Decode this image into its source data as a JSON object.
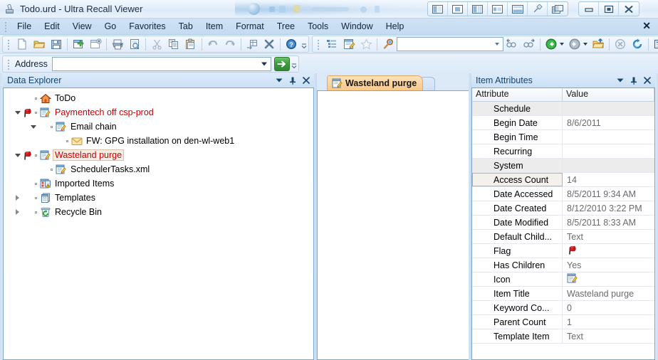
{
  "window": {
    "title": "Todo.urd - Ultra Recall Viewer",
    "icon": "ultrarecall-icon",
    "layout_buttons": [
      {
        "name": "layout-left-pane-icon",
        "label": ""
      },
      {
        "name": "layout-center-pane-icon",
        "label": ""
      },
      {
        "name": "layout-right-pane-icon",
        "label": ""
      },
      {
        "name": "layout-split-pane-icon",
        "label": ""
      },
      {
        "name": "layout-horizontal-split-icon",
        "label": ""
      },
      {
        "name": "pin-layout-icon",
        "label": ""
      },
      {
        "name": "layout-overlay-icon",
        "label": ""
      }
    ],
    "controls": [
      {
        "name": "minimize-button",
        "glyph": "minimize"
      },
      {
        "name": "restore-button",
        "glyph": "restore"
      },
      {
        "name": "close-button",
        "glyph": "close"
      }
    ]
  },
  "menubar": {
    "items": [
      "File",
      "Edit",
      "View",
      "Go",
      "Favorites",
      "Tab",
      "Item",
      "Format",
      "Tree",
      "Tools",
      "Window",
      "Help"
    ],
    "close_label": "✕"
  },
  "toolbar_main": {
    "buttons": [
      "new-document-icon",
      "open-folder-icon",
      "save-icon",
      "new-item-icon",
      "close-item-icon",
      "print-icon",
      "print-preview-icon",
      "cut-icon",
      "copy-icon",
      "paste-icon",
      "undo-icon",
      "redo-icon",
      "insert-object-icon",
      "delete-icon",
      "help-icon"
    ],
    "overflow_label": "»"
  },
  "toolbar_secondary": {
    "buttons": [
      "outline-view-icon",
      "edit-item-icon",
      "favorite-star-icon"
    ],
    "search_icon": "search-magnifier-icon",
    "search_value": "",
    "search_placeholder": "",
    "nav_buttons": [
      "find-previous-icon",
      "find-next-icon",
      "back-icon",
      "back-dropdown-icon",
      "forward-icon",
      "forward-dropdown-icon",
      "go-up-folder-icon",
      "stop-icon",
      "refresh-icon",
      "view-mode-icon",
      "view-mode-dropdown-icon",
      "columns-icon"
    ],
    "overflow_label": "»"
  },
  "address_bar": {
    "label": "Address",
    "value": "",
    "placeholder": "",
    "go_button": "go-arrow-button",
    "overflow_label": "»"
  },
  "data_explorer": {
    "title": "Data Explorer",
    "header_buttons": [
      {
        "name": "panel-menu-dropdown",
        "glyph": "▼"
      },
      {
        "name": "panel-pin-button",
        "glyph": "pin"
      },
      {
        "name": "panel-close-button",
        "glyph": "✕"
      }
    ],
    "tree": [
      {
        "label": "ToDo",
        "icon": "home-icon",
        "indent": 0,
        "expander": "none",
        "flag": false,
        "color": "black",
        "selected": false
      },
      {
        "label": "Paymentech off csp-prod",
        "icon": "note-edit-icon",
        "indent": 0,
        "expander": "open",
        "flag": true,
        "color": "red",
        "selected": false
      },
      {
        "label": "Email chain",
        "icon": "note-edit-icon",
        "indent": 1,
        "expander": "open",
        "flag": false,
        "color": "black",
        "selected": false
      },
      {
        "label": "FW: GPG installation on den-wl-web1",
        "icon": "envelope-icon",
        "indent": 2,
        "expander": "none",
        "flag": false,
        "color": "black",
        "selected": false
      },
      {
        "label": "Wasteland purge",
        "icon": "note-edit-icon",
        "indent": 0,
        "expander": "open",
        "flag": true,
        "color": "red",
        "selected": true
      },
      {
        "label": "SchedulerTasks.xml",
        "icon": "note-edit-icon",
        "indent": 1,
        "expander": "none",
        "flag": false,
        "color": "black",
        "selected": false
      },
      {
        "label": "Imported Items",
        "icon": "imported-items-icon",
        "indent": 0,
        "expander": "none",
        "flag": false,
        "color": "black",
        "selected": false
      },
      {
        "label": "Templates",
        "icon": "templates-icon",
        "indent": 0,
        "expander": "closed",
        "flag": false,
        "color": "black",
        "selected": false
      },
      {
        "label": "Recycle Bin",
        "icon": "recycle-bin-icon",
        "indent": 0,
        "expander": "closed",
        "flag": false,
        "color": "black",
        "selected": false
      }
    ]
  },
  "document_area": {
    "active_tab": "Wasteland purge",
    "active_tab_icon": "note-edit-icon",
    "new_tab_name": "new-tab-button",
    "content": ""
  },
  "item_attributes": {
    "title": "Item Attributes",
    "header_buttons": [
      {
        "name": "panel-menu-dropdown",
        "glyph": "▼"
      },
      {
        "name": "panel-pin-button",
        "glyph": "pin"
      },
      {
        "name": "panel-close-button",
        "glyph": "✕"
      }
    ],
    "columns": [
      "Attribute",
      "Value"
    ],
    "rows": [
      {
        "attribute": "Schedule",
        "value": "",
        "group": true,
        "selected": false,
        "icon": null
      },
      {
        "attribute": "Begin Date",
        "value": "8/6/2011",
        "group": false,
        "selected": false,
        "icon": null
      },
      {
        "attribute": "Begin Time",
        "value": "",
        "group": false,
        "selected": false,
        "icon": null
      },
      {
        "attribute": "Recurring",
        "value": "",
        "group": false,
        "selected": false,
        "icon": null
      },
      {
        "attribute": "System",
        "value": "",
        "group": true,
        "selected": false,
        "icon": null
      },
      {
        "attribute": "Access Count",
        "value": "14",
        "group": false,
        "selected": true,
        "icon": null
      },
      {
        "attribute": "Date Accessed",
        "value": "8/5/2011 9:34 AM",
        "group": false,
        "selected": false,
        "icon": null
      },
      {
        "attribute": "Date Created",
        "value": "8/12/2010 3:22 PM",
        "group": false,
        "selected": false,
        "icon": null
      },
      {
        "attribute": "Date Modified",
        "value": "8/5/2011 8:33 AM",
        "group": false,
        "selected": false,
        "icon": null
      },
      {
        "attribute": "Default Child...",
        "value": "Text",
        "group": false,
        "selected": false,
        "icon": null
      },
      {
        "attribute": "Flag",
        "value": "",
        "group": false,
        "selected": false,
        "icon": "flag-icon"
      },
      {
        "attribute": "Has Children",
        "value": "Yes",
        "group": false,
        "selected": false,
        "icon": null
      },
      {
        "attribute": "Icon",
        "value": "",
        "group": false,
        "selected": false,
        "icon": "note-edit-icon"
      },
      {
        "attribute": "Item Title",
        "value": "Wasteland purge",
        "group": false,
        "selected": false,
        "icon": null
      },
      {
        "attribute": "Keyword Co...",
        "value": "0",
        "group": false,
        "selected": false,
        "icon": null
      },
      {
        "attribute": "Parent Count",
        "value": "1",
        "group": false,
        "selected": false,
        "icon": null
      },
      {
        "attribute": "Template Item",
        "value": "Text",
        "group": false,
        "selected": false,
        "icon": null
      }
    ]
  },
  "colors": {
    "accent": "#15436b",
    "flag_red": "#cc0000",
    "tab_orange": "#fbd099",
    "go_green": "#3d9a3d",
    "group_gray": "#ececec"
  }
}
